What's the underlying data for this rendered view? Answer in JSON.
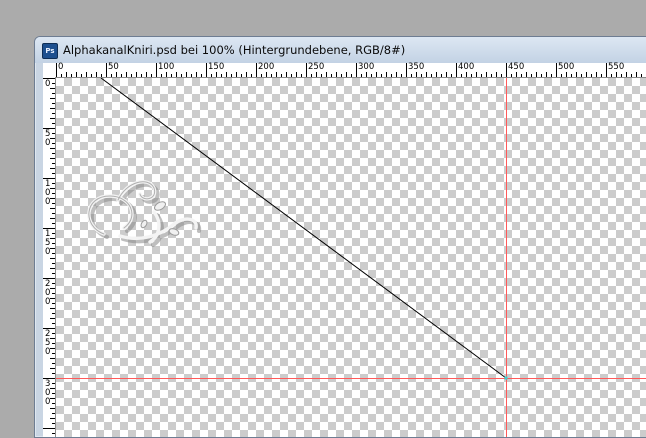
{
  "window": {
    "title": "AlphakanalKniri.psd bei 100% (Hintergrundebene, RGB/8#)",
    "app_icon": "photoshop-icon",
    "app_icon_text": "Ps"
  },
  "ruler": {
    "unit": "px",
    "h_labels": [
      "0",
      "50",
      "100",
      "150",
      "200",
      "250",
      "300",
      "350",
      "400",
      "450",
      "500",
      "550"
    ],
    "v_labels": [
      "0",
      "50",
      "100",
      "150",
      "200",
      "250",
      "300"
    ]
  },
  "guides": {
    "color": "#ff5a5a",
    "vertical_at": 450,
    "horizontal_at": 300
  },
  "line": {
    "color": "#000000",
    "from": [
      45,
      0
    ],
    "to": [
      450,
      300
    ]
  },
  "colors": {
    "checker": "#cccccc",
    "background": "#ababab"
  }
}
